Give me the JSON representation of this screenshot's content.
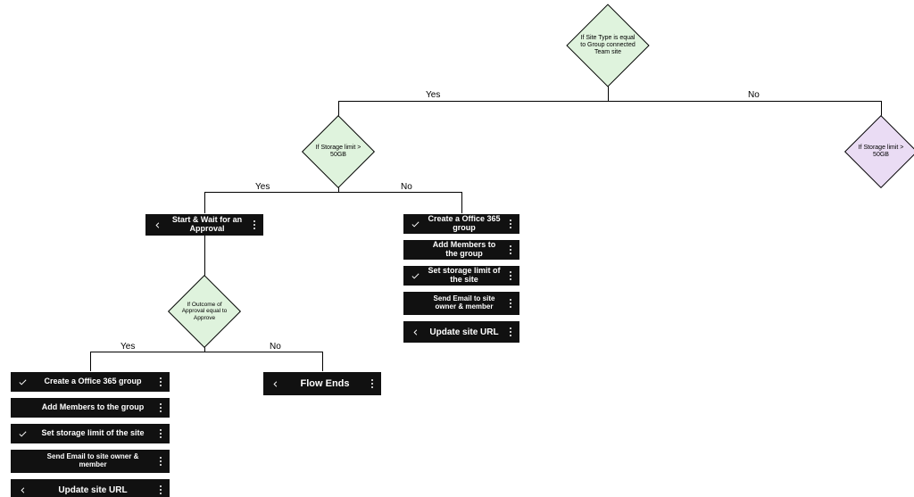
{
  "labels": {
    "yes": "Yes",
    "no": "No"
  },
  "decisions": {
    "d1": "If Site Type is equal to Group connected Team site",
    "d2": "If Storage limit > 50GB",
    "d3": "If Storage limit > 50GB",
    "d4": "If Outcome of Approval equal to Approve"
  },
  "actions": {
    "startWait": "Start & Wait for an Approval",
    "createGroup": "Create a Office 365 group",
    "addMembers": "Add Members to the group",
    "setStorage": "Set storage limit of the site",
    "sendEmail": "Send Email to site owner & member",
    "updateUrl": "Update site URL",
    "flowEnds": "Flow Ends"
  },
  "chart_data": {
    "type": "flowchart",
    "nodes": [
      {
        "id": "d1",
        "type": "decision",
        "text": "If Site Type is equal to Group connected Team site",
        "color": "green"
      },
      {
        "id": "d2",
        "type": "decision",
        "text": "If Storage limit > 50GB",
        "color": "green"
      },
      {
        "id": "d3",
        "type": "decision",
        "text": "If Storage limit > 50GB",
        "color": "purple"
      },
      {
        "id": "d4",
        "type": "decision",
        "text": "If Outcome of Approval equal to Approve",
        "color": "green"
      },
      {
        "id": "a1",
        "type": "action",
        "text": "Start & Wait for an Approval"
      },
      {
        "id": "g1",
        "type": "action-group",
        "steps": [
          "Create a Office 365 group",
          "Add Members to the group",
          "Set storage limit of the site",
          "Send Email to site owner & member",
          "Update site URL"
        ]
      },
      {
        "id": "g2",
        "type": "action-group",
        "steps": [
          "Create a Office 365 group",
          "Add Members to the group",
          "Set storage limit of the site",
          "Send Email to site owner & member",
          "Update site URL"
        ]
      },
      {
        "id": "a2",
        "type": "action",
        "text": "Flow Ends"
      }
    ],
    "edges": [
      {
        "from": "d1",
        "to": "d2",
        "label": "Yes"
      },
      {
        "from": "d1",
        "to": "d3",
        "label": "No"
      },
      {
        "from": "d2",
        "to": "a1",
        "label": "Yes"
      },
      {
        "from": "d2",
        "to": "g1",
        "label": "No"
      },
      {
        "from": "a1",
        "to": "d4",
        "label": ""
      },
      {
        "from": "d4",
        "to": "g2",
        "label": "Yes"
      },
      {
        "from": "d4",
        "to": "a2",
        "label": "No"
      }
    ]
  }
}
